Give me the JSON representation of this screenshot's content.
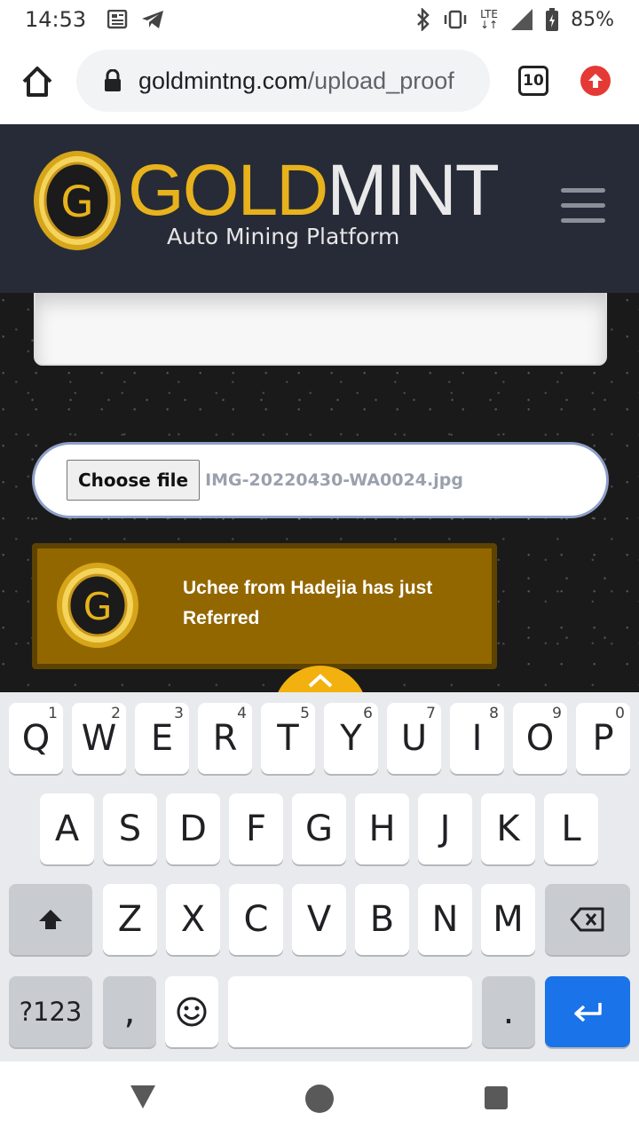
{
  "status_bar": {
    "time": "14:53",
    "battery": "85%",
    "network": "LTE",
    "icons": [
      "news-icon",
      "telegram-icon",
      "bluetooth-icon",
      "vibrate-icon",
      "lte-icon",
      "signal-icon",
      "battery-icon"
    ]
  },
  "browser": {
    "url_domain": "goldmintng.com",
    "url_path": "/upload_proof",
    "tab_count": "10"
  },
  "site": {
    "brand_gold": "GOLD",
    "brand_mint": "MINT",
    "tagline": "Auto Mining Platform",
    "logo_letter": "G"
  },
  "upload": {
    "button_label": "Choose file",
    "file_name": "IMG-20220430-WA0024.jpg"
  },
  "notification": {
    "text": "Uchee from Hadejia has just Referred"
  },
  "keyboard": {
    "row1": [
      {
        "key": "Q",
        "hint": "1"
      },
      {
        "key": "W",
        "hint": "2"
      },
      {
        "key": "E",
        "hint": "3"
      },
      {
        "key": "R",
        "hint": "4"
      },
      {
        "key": "T",
        "hint": "5"
      },
      {
        "key": "Y",
        "hint": "6"
      },
      {
        "key": "U",
        "hint": "7"
      },
      {
        "key": "I",
        "hint": "8"
      },
      {
        "key": "O",
        "hint": "9"
      },
      {
        "key": "P",
        "hint": "0"
      }
    ],
    "row2": [
      "A",
      "S",
      "D",
      "F",
      "G",
      "H",
      "J",
      "K",
      "L"
    ],
    "row3": [
      "Z",
      "X",
      "C",
      "V",
      "B",
      "N",
      "M"
    ],
    "symbols_label": "?123",
    "comma": ",",
    "period": "."
  },
  "colors": {
    "brand_gold": "#e7b21c",
    "header_bg": "#272b37",
    "toast_bg": "#936700",
    "enter_key": "#1a73e8"
  }
}
